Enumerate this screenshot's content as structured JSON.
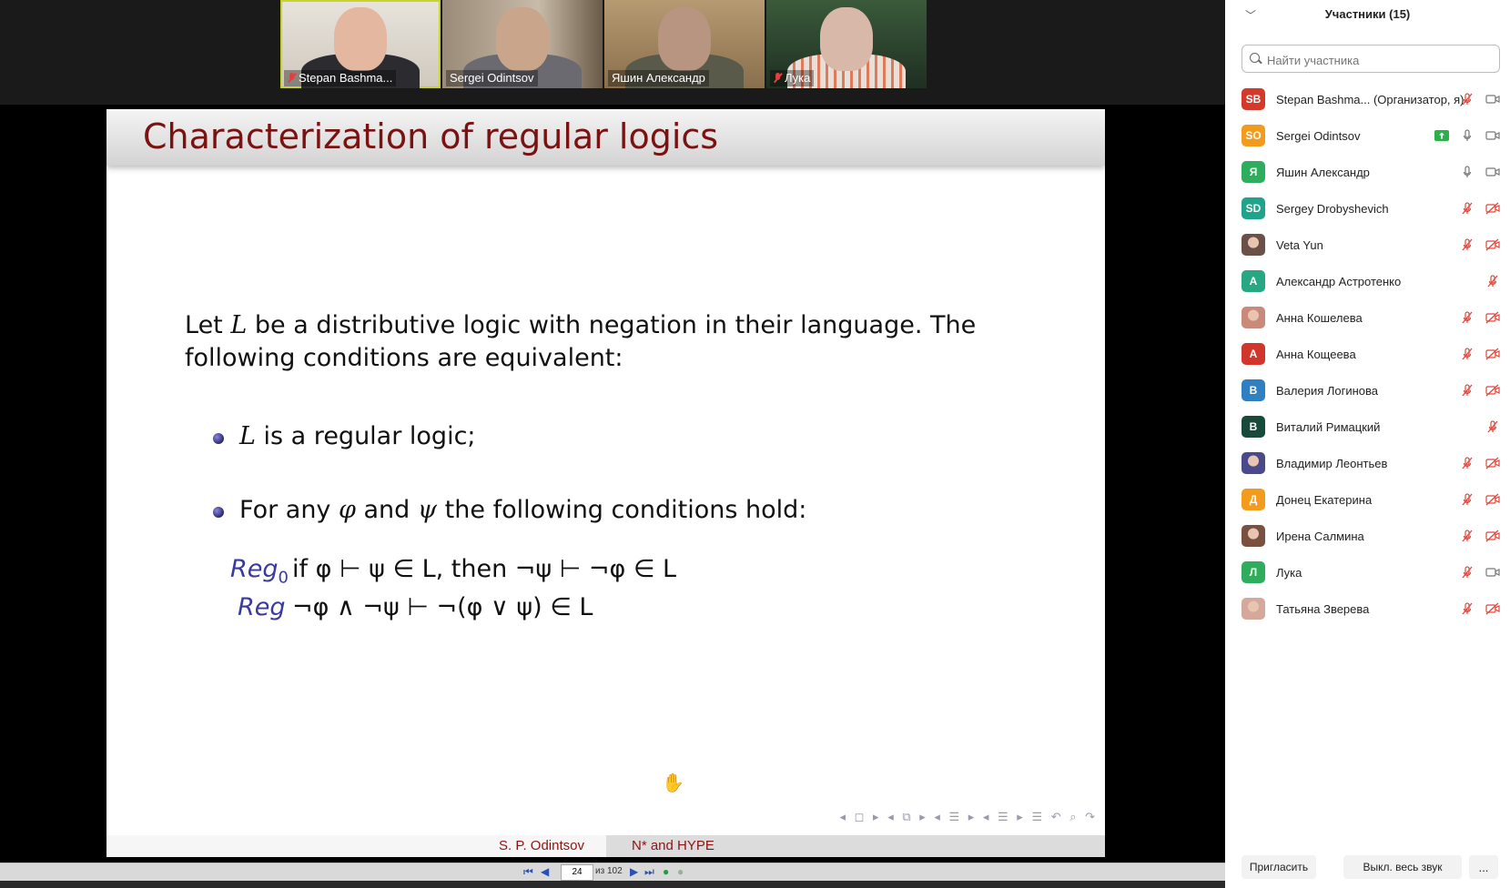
{
  "video_thumbnails": [
    {
      "name": "Stepan Bashma...",
      "muted": true
    },
    {
      "name": "Sergei Odintsov",
      "muted": false
    },
    {
      "name": "Яшин Александр",
      "muted": false
    },
    {
      "name": "Лука",
      "muted": true
    }
  ],
  "slide": {
    "title": "Characterization of regular logics",
    "intro_line1_pre": "Let",
    "intro_L": "L",
    "intro_line1_post": "be a distributive logic with negation in their language.  The",
    "intro_line2": "following conditions are equivalent:",
    "bullet1_L": "L",
    "bullet1_text": "is a regular logic;",
    "bullet2_pre": "For any",
    "bullet2_phi": "φ",
    "bullet2_and": "and",
    "bullet2_psi": "ψ",
    "bullet2_post": "the following conditions hold:",
    "reg0_name": "Reg",
    "reg0_sub": "0",
    "reg0_formula": "if φ ⊢ ψ ∈ L, then ¬ψ ⊢ ¬φ ∈ L",
    "reg_name": "Reg",
    "reg_formula": "¬φ ∧ ¬ψ ⊢ ¬(φ ∨ ψ) ∈ L",
    "nav_symbols": "◂ ◻ ▸  ◂ ⧉ ▸  ◂ ☰ ▸  ◂ ☰ ▸   ☰   ↶ ⌕ ↷",
    "footer_author": "S. P. Odintsov",
    "footer_topic": "N* and HYPE"
  },
  "pdf_toolbar": {
    "page_value": "24",
    "page_of": "из 102"
  },
  "panel": {
    "title": "Участники (15)",
    "search_placeholder": "Найти участника",
    "participants": [
      {
        "initials": "SB",
        "color": "#d33a2c",
        "name": "Stepan Bashma... (Организатор, я)",
        "mic": "off",
        "cam": "on"
      },
      {
        "initials": "SO",
        "color": "#f29b1d",
        "name": "Sergei Odintsov",
        "mic": "on",
        "cam": "on",
        "sharing": true
      },
      {
        "initials": "Я",
        "color": "#2eae5c",
        "name": "Яшин Александр",
        "mic": "on",
        "cam": "on"
      },
      {
        "initials": "SD",
        "color": "#1fa38a",
        "name": "Sergey Drobyshevich",
        "mic": "off",
        "cam": "off"
      },
      {
        "initials": "",
        "color": "#6b5048",
        "name": "Veta Yun",
        "mic": "off",
        "cam": "off"
      },
      {
        "initials": "A",
        "color": "#27a882",
        "name": "Александр Астротенко",
        "mic": "off",
        "cam": "none"
      },
      {
        "initials": "",
        "color": "#c98a7a",
        "name": "Анна Кошелева",
        "mic": "off",
        "cam": "off"
      },
      {
        "initials": "A",
        "color": "#d0362b",
        "name": "Анна Кощеева",
        "mic": "off",
        "cam": "off"
      },
      {
        "initials": "B",
        "color": "#2f7fc1",
        "name": "Валерия Логинова",
        "mic": "off",
        "cam": "off"
      },
      {
        "initials": "B",
        "color": "#174a3a",
        "name": "Виталий Римацкий",
        "mic": "off",
        "cam": "none"
      },
      {
        "initials": "",
        "color": "#4a4a8a",
        "name": "Владимир Леонтьев",
        "mic": "off",
        "cam": "off"
      },
      {
        "initials": "Д",
        "color": "#f29b1d",
        "name": "Донец Екатерина",
        "mic": "off",
        "cam": "off"
      },
      {
        "initials": "",
        "color": "#7a5040",
        "name": "Ирена Салмина",
        "mic": "off",
        "cam": "off"
      },
      {
        "initials": "Л",
        "color": "#2eae5c",
        "name": "Лука",
        "mic": "off",
        "cam": "on"
      },
      {
        "initials": "",
        "color": "#d4a89a",
        "name": "Татьяна Зверева",
        "mic": "off",
        "cam": "off"
      }
    ],
    "invite_label": "Пригласить",
    "mute_all_label": "Выкл. весь звук",
    "more_label": "..."
  }
}
